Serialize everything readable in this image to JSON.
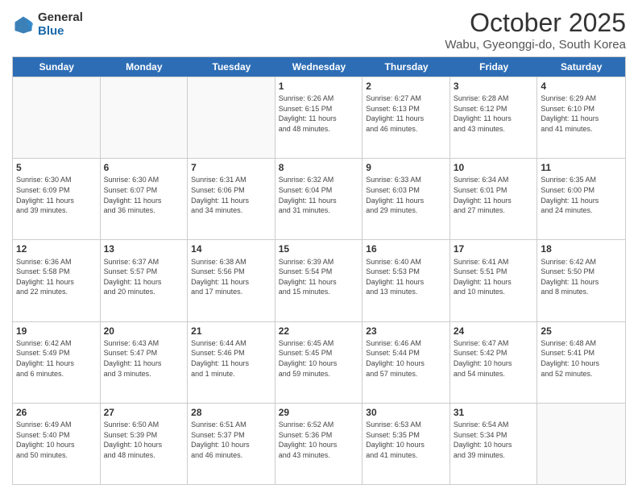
{
  "header": {
    "logo_general": "General",
    "logo_blue": "Blue",
    "month_title": "October 2025",
    "location": "Wabu, Gyeonggi-do, South Korea"
  },
  "calendar": {
    "days_of_week": [
      "Sunday",
      "Monday",
      "Tuesday",
      "Wednesday",
      "Thursday",
      "Friday",
      "Saturday"
    ],
    "rows": [
      [
        {
          "day": "",
          "info": ""
        },
        {
          "day": "",
          "info": ""
        },
        {
          "day": "",
          "info": ""
        },
        {
          "day": "1",
          "info": "Sunrise: 6:26 AM\nSunset: 6:15 PM\nDaylight: 11 hours\nand 48 minutes."
        },
        {
          "day": "2",
          "info": "Sunrise: 6:27 AM\nSunset: 6:13 PM\nDaylight: 11 hours\nand 46 minutes."
        },
        {
          "day": "3",
          "info": "Sunrise: 6:28 AM\nSunset: 6:12 PM\nDaylight: 11 hours\nand 43 minutes."
        },
        {
          "day": "4",
          "info": "Sunrise: 6:29 AM\nSunset: 6:10 PM\nDaylight: 11 hours\nand 41 minutes."
        }
      ],
      [
        {
          "day": "5",
          "info": "Sunrise: 6:30 AM\nSunset: 6:09 PM\nDaylight: 11 hours\nand 39 minutes."
        },
        {
          "day": "6",
          "info": "Sunrise: 6:30 AM\nSunset: 6:07 PM\nDaylight: 11 hours\nand 36 minutes."
        },
        {
          "day": "7",
          "info": "Sunrise: 6:31 AM\nSunset: 6:06 PM\nDaylight: 11 hours\nand 34 minutes."
        },
        {
          "day": "8",
          "info": "Sunrise: 6:32 AM\nSunset: 6:04 PM\nDaylight: 11 hours\nand 31 minutes."
        },
        {
          "day": "9",
          "info": "Sunrise: 6:33 AM\nSunset: 6:03 PM\nDaylight: 11 hours\nand 29 minutes."
        },
        {
          "day": "10",
          "info": "Sunrise: 6:34 AM\nSunset: 6:01 PM\nDaylight: 11 hours\nand 27 minutes."
        },
        {
          "day": "11",
          "info": "Sunrise: 6:35 AM\nSunset: 6:00 PM\nDaylight: 11 hours\nand 24 minutes."
        }
      ],
      [
        {
          "day": "12",
          "info": "Sunrise: 6:36 AM\nSunset: 5:58 PM\nDaylight: 11 hours\nand 22 minutes."
        },
        {
          "day": "13",
          "info": "Sunrise: 6:37 AM\nSunset: 5:57 PM\nDaylight: 11 hours\nand 20 minutes."
        },
        {
          "day": "14",
          "info": "Sunrise: 6:38 AM\nSunset: 5:56 PM\nDaylight: 11 hours\nand 17 minutes."
        },
        {
          "day": "15",
          "info": "Sunrise: 6:39 AM\nSunset: 5:54 PM\nDaylight: 11 hours\nand 15 minutes."
        },
        {
          "day": "16",
          "info": "Sunrise: 6:40 AM\nSunset: 5:53 PM\nDaylight: 11 hours\nand 13 minutes."
        },
        {
          "day": "17",
          "info": "Sunrise: 6:41 AM\nSunset: 5:51 PM\nDaylight: 11 hours\nand 10 minutes."
        },
        {
          "day": "18",
          "info": "Sunrise: 6:42 AM\nSunset: 5:50 PM\nDaylight: 11 hours\nand 8 minutes."
        }
      ],
      [
        {
          "day": "19",
          "info": "Sunrise: 6:42 AM\nSunset: 5:49 PM\nDaylight: 11 hours\nand 6 minutes."
        },
        {
          "day": "20",
          "info": "Sunrise: 6:43 AM\nSunset: 5:47 PM\nDaylight: 11 hours\nand 3 minutes."
        },
        {
          "day": "21",
          "info": "Sunrise: 6:44 AM\nSunset: 5:46 PM\nDaylight: 11 hours\nand 1 minute."
        },
        {
          "day": "22",
          "info": "Sunrise: 6:45 AM\nSunset: 5:45 PM\nDaylight: 10 hours\nand 59 minutes."
        },
        {
          "day": "23",
          "info": "Sunrise: 6:46 AM\nSunset: 5:44 PM\nDaylight: 10 hours\nand 57 minutes."
        },
        {
          "day": "24",
          "info": "Sunrise: 6:47 AM\nSunset: 5:42 PM\nDaylight: 10 hours\nand 54 minutes."
        },
        {
          "day": "25",
          "info": "Sunrise: 6:48 AM\nSunset: 5:41 PM\nDaylight: 10 hours\nand 52 minutes."
        }
      ],
      [
        {
          "day": "26",
          "info": "Sunrise: 6:49 AM\nSunset: 5:40 PM\nDaylight: 10 hours\nand 50 minutes."
        },
        {
          "day": "27",
          "info": "Sunrise: 6:50 AM\nSunset: 5:39 PM\nDaylight: 10 hours\nand 48 minutes."
        },
        {
          "day": "28",
          "info": "Sunrise: 6:51 AM\nSunset: 5:37 PM\nDaylight: 10 hours\nand 46 minutes."
        },
        {
          "day": "29",
          "info": "Sunrise: 6:52 AM\nSunset: 5:36 PM\nDaylight: 10 hours\nand 43 minutes."
        },
        {
          "day": "30",
          "info": "Sunrise: 6:53 AM\nSunset: 5:35 PM\nDaylight: 10 hours\nand 41 minutes."
        },
        {
          "day": "31",
          "info": "Sunrise: 6:54 AM\nSunset: 5:34 PM\nDaylight: 10 hours\nand 39 minutes."
        },
        {
          "day": "",
          "info": ""
        }
      ]
    ]
  }
}
